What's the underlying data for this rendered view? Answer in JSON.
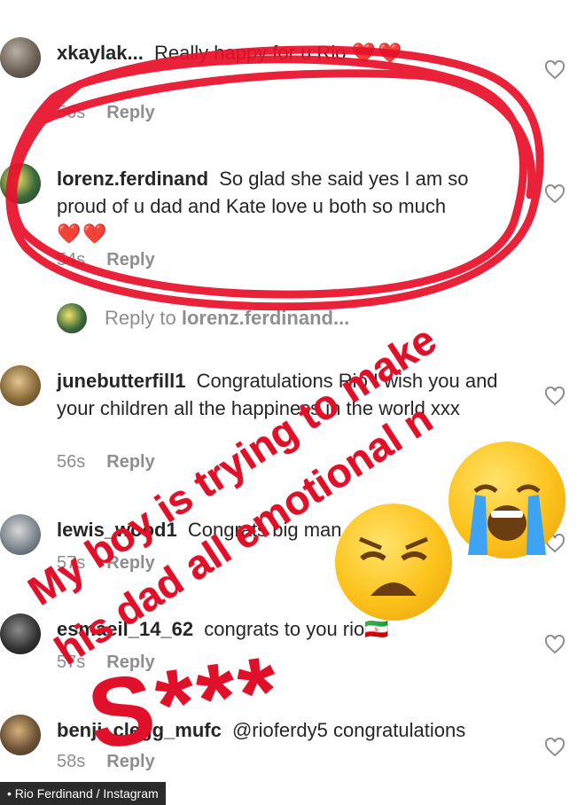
{
  "comments": [
    {
      "username": "xkaylak...",
      "text": "Really happy for u Rio",
      "hearts": "❤️❤️",
      "time": "56s",
      "reply": "Reply"
    },
    {
      "username": "lorenz.ferdinand",
      "text": "So glad she said yes I am so proud of u dad and Kate love u both so much",
      "hearts": "❤️❤️",
      "time": "54s",
      "reply": "Reply"
    },
    {
      "username": "junebutterfill1",
      "text": "Congratulations Rio I wish you and your children all the happiness in the world xxx",
      "time": "56s",
      "reply": "Reply"
    },
    {
      "username": "lewis_wood1",
      "text": "Congrats big man",
      "time": "57s",
      "reply": "Reply"
    },
    {
      "username": "esmaeil_14_62",
      "text": "congrats to you rio🇮🇷",
      "time": "57s",
      "reply": "Reply"
    },
    {
      "username": "benji_clegg_mufc",
      "text": "@rioferdy5 congratulations",
      "time": "58s",
      "reply": "Reply"
    }
  ],
  "reply_to": {
    "prefix": "Reply to ",
    "username": "lorenz.ferdinand..."
  },
  "story": {
    "line1": "My boy is trying to make",
    "line2": "his dad all emotional n",
    "line3": "S***"
  },
  "credit": "• Rio Ferdinand / Instagram",
  "colors": {
    "story_red": "#e0102a",
    "meta_grey": "#8e8e8e",
    "heart_red": "#e0245e"
  }
}
